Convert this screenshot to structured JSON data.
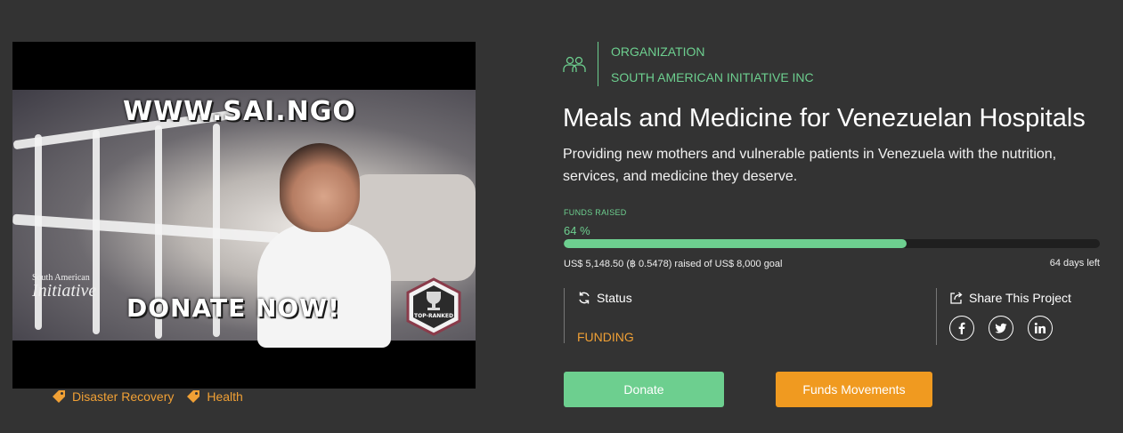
{
  "video": {
    "overlay_top_text": "WWW.SAI.NGO",
    "overlay_bottom_text": "DONATE NOW!",
    "logo_small": "South American",
    "logo_big": "Initiative",
    "badge_text": "TOP-RANKED"
  },
  "tags": [
    {
      "label": "Disaster Recovery",
      "icon": "tag-icon"
    },
    {
      "label": "Health",
      "icon": "tag-icon"
    }
  ],
  "organization": {
    "label": "ORGANIZATION",
    "name": "SOUTH AMERICAN INITIATIVE INC",
    "icon": "people-icon"
  },
  "project": {
    "title": "Meals and Medicine for Venezuelan Hospitals",
    "description": "Providing new mothers and vulnerable patients in Venezuela with the nutrition, services, and medicine they deserve."
  },
  "funds": {
    "label": "FUNDS RAISED",
    "percent_text": "64 %",
    "percent": 64,
    "raised_text": "US$ 5,148.50 (฿ 0.5478) raised of US$ 8,000 goal",
    "days_left": "64 days left"
  },
  "status": {
    "label": "Status",
    "value": "FUNDING",
    "icon": "refresh-icon"
  },
  "share": {
    "label": "Share This Project",
    "icon": "share-icon",
    "networks": [
      "facebook-icon",
      "twitter-icon",
      "linkedin-icon"
    ]
  },
  "buttons": {
    "donate": "Donate",
    "funds_movements": "Funds Movements"
  },
  "colors": {
    "accent_green": "#6dcf8f",
    "accent_orange": "#f09a20",
    "background": "#333333"
  }
}
